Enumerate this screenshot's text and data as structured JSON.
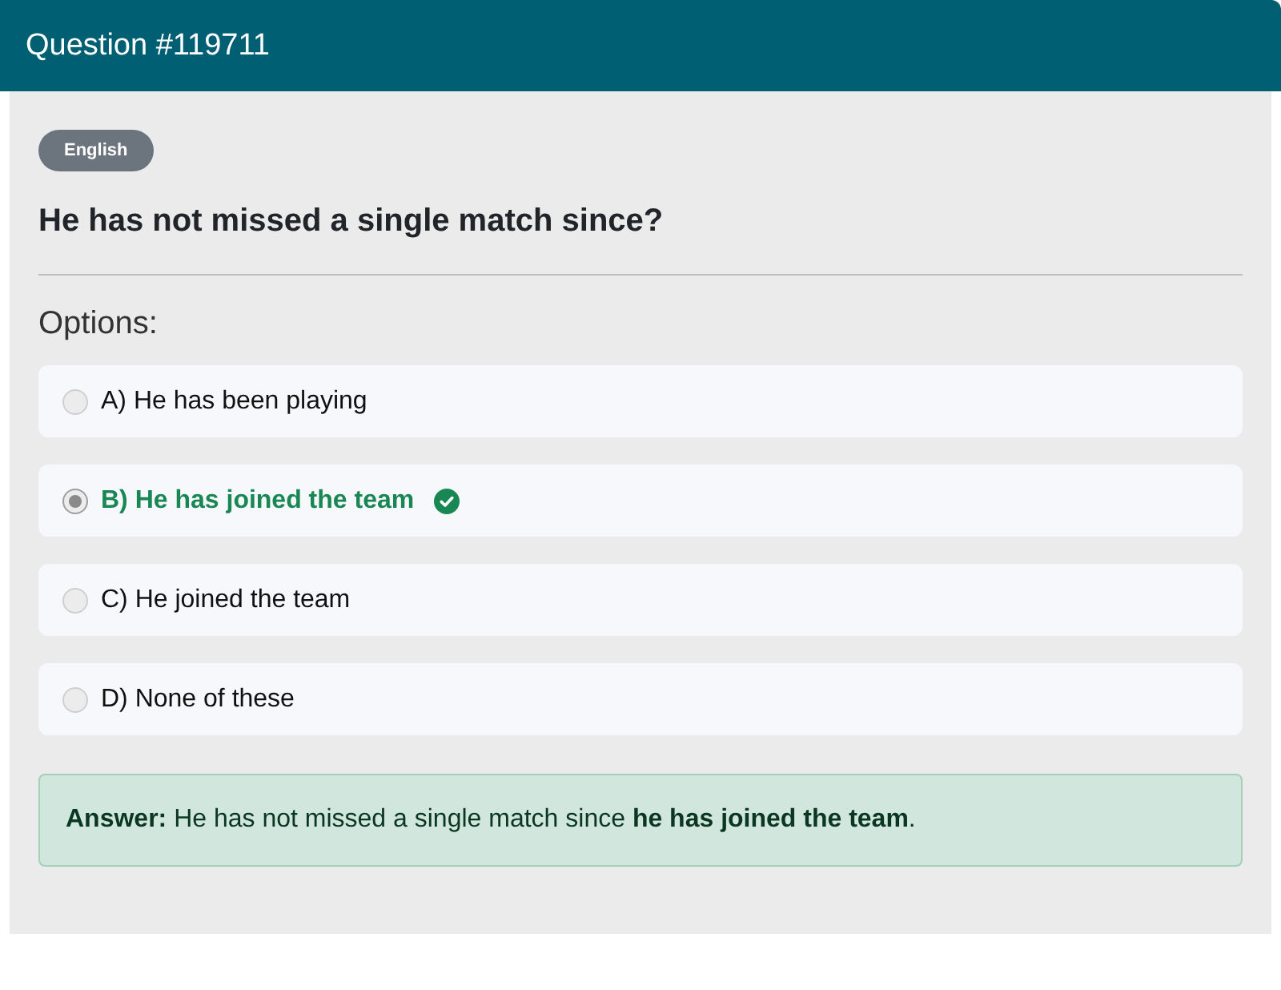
{
  "header": {
    "title": "Question #119711"
  },
  "language_badge": "English",
  "question": "He has not missed a single match since?",
  "options_label": "Options:",
  "options": [
    {
      "label": "A) He has been playing",
      "selected": false,
      "correct": false
    },
    {
      "label": "B) He has joined the team",
      "selected": true,
      "correct": true
    },
    {
      "label": "C) He joined the team",
      "selected": false,
      "correct": false
    },
    {
      "label": "D) None of these",
      "selected": false,
      "correct": false
    }
  ],
  "answer": {
    "text": "**Answer:** He has not missed a single match since **he has joined the team**."
  }
}
